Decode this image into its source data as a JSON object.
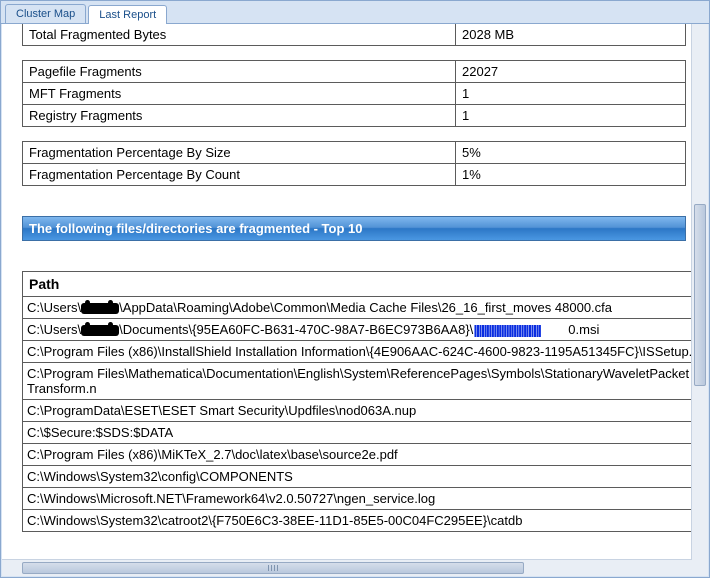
{
  "tabs": {
    "clusterMap": "Cluster Map",
    "lastReport": "Last Report"
  },
  "stats1": {
    "totalFragmentedBytes": {
      "label": "Total Fragmented Bytes",
      "value": "2028 MB"
    }
  },
  "stats2": {
    "pagefileFragments": {
      "label": "Pagefile Fragments",
      "value": "22027"
    },
    "mftFragments": {
      "label": "MFT Fragments",
      "value": "1"
    },
    "registryFragments": {
      "label": "Registry Fragments",
      "value": "1"
    }
  },
  "stats3": {
    "fragBySize": {
      "label": "Fragmentation Percentage By Size",
      "value": "5%"
    },
    "fragByCount": {
      "label": "Fragmentation Percentage By Count",
      "value": "1%"
    }
  },
  "sectionHeader": "The following files/directories are fragmented - Top 10",
  "pathHeader": "Path",
  "paths": {
    "p0a": "C:\\Users\\",
    "p0b": "\\AppData\\Roaming\\Adobe\\Common\\Media Cache Files\\26_16_first_moves 48000.cfa",
    "p1a": "C:\\Users\\",
    "p1b": "\\Documents\\{95EA60FC-B631-470C-98A7-B6EC973B6AA8}\\",
    "p1c": "0.msi",
    "p2": "C:\\Program Files (x86)\\InstallShield Installation Information\\{4E906AAC-624C-4600-9823-1195A51345FC}\\ISSetup.",
    "p3": "C:\\Program Files\\Mathematica\\Documentation\\English\\System\\ReferencePages\\Symbols\\StationaryWaveletPacketTransform.n",
    "p4": "C:\\ProgramData\\ESET\\ESET Smart Security\\Updfiles\\nod063A.nup",
    "p5": "C:\\$Secure:$SDS:$DATA",
    "p6": "C:\\Program Files (x86)\\MiKTeX_2.7\\doc\\latex\\base\\source2e.pdf",
    "p7": "C:\\Windows\\System32\\config\\COMPONENTS",
    "p8": "C:\\Windows\\Microsoft.NET\\Framework64\\v2.0.50727\\ngen_service.log",
    "p9": "C:\\Windows\\System32\\catroot2\\{F750E6C3-38EE-11D1-85E5-00C04FC295EE}\\catdb"
  }
}
